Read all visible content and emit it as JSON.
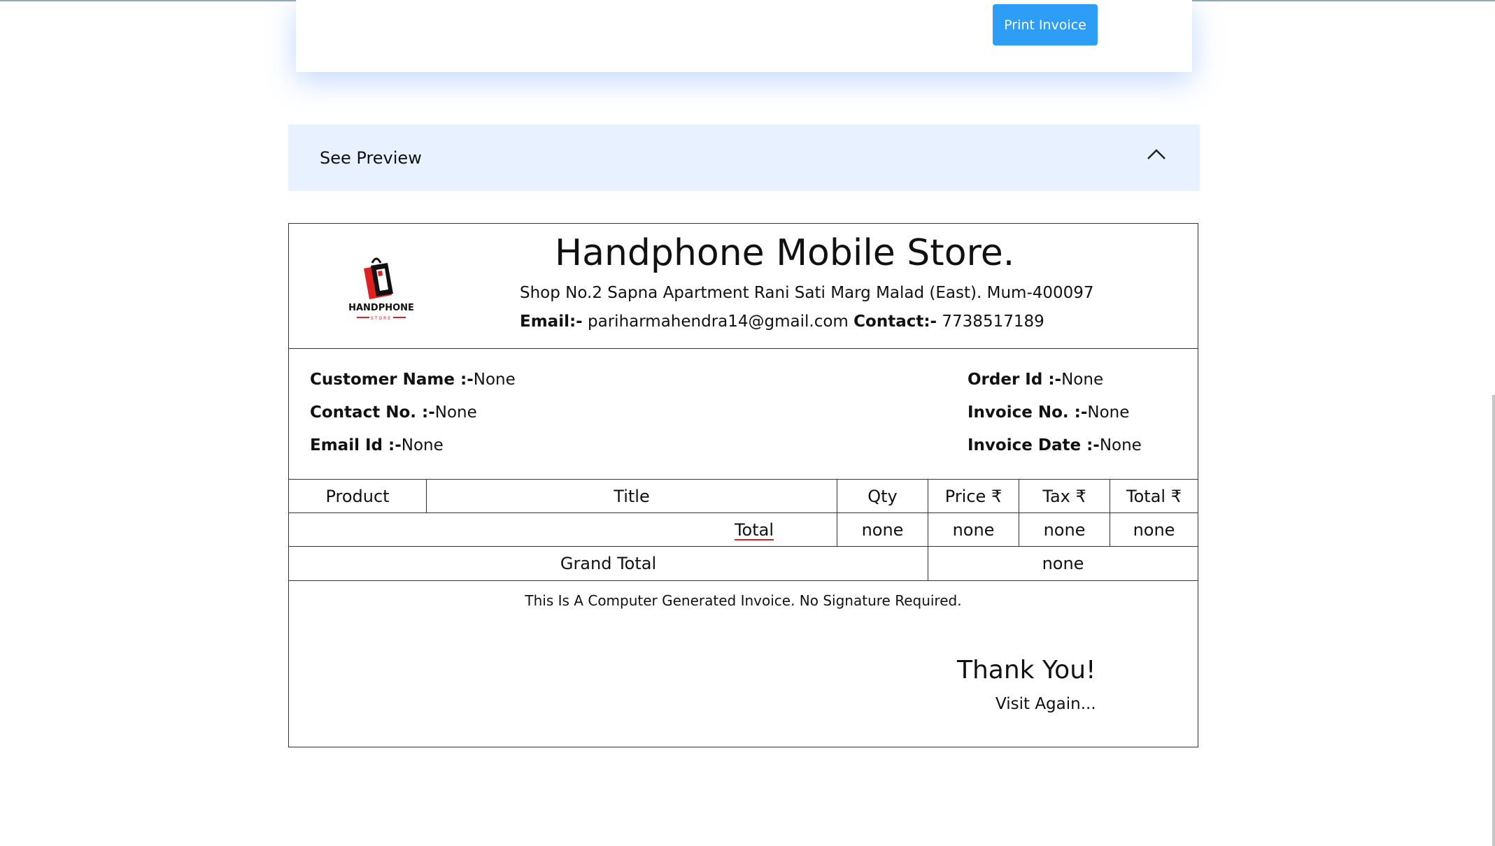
{
  "toolbar": {
    "print_label": "Print Invoice"
  },
  "accordion": {
    "title": "See Preview"
  },
  "store": {
    "name": "Handphone Mobile Store.",
    "address": "Shop No.2 Sapna Apartment Rani Sati Marg Malad (East). Mum-400097",
    "email_label": "Email:-",
    "email": "pariharmahendra14@gmail.com",
    "contact_label": "Contact:-",
    "contact": "7738517189",
    "logo_text": "HANDPHONE",
    "logo_subtext": "STORE"
  },
  "customer": {
    "name_label": "Customer Name :-",
    "name_value": "None",
    "contact_label": "Contact No. :-",
    "contact_value": "None",
    "email_label": "Email Id :-",
    "email_value": "None"
  },
  "order": {
    "order_id_label": "Order Id :-",
    "order_id_value": "None",
    "invoice_no_label": "Invoice No. :-",
    "invoice_no_value": "None",
    "invoice_date_label": "Invoice Date :-",
    "invoice_date_value": "None"
  },
  "table": {
    "headers": [
      "Product",
      "Title",
      "Qty",
      "Price ₹",
      "Tax ₹",
      "Total ₹"
    ],
    "total_label": "Total",
    "totals": [
      "none",
      "none",
      "none",
      "none"
    ],
    "grand_total_label": "Grand Total",
    "grand_total_value": "none"
  },
  "footer": {
    "note": "This Is A Computer Generated Invoice. No Signature Required.",
    "thanks": "Thank You!",
    "visit": "Visit Again..."
  },
  "colors": {
    "accent": "#2d9df5",
    "accordion_bg": "#e8f1ff",
    "total_underline": "#e02020"
  }
}
